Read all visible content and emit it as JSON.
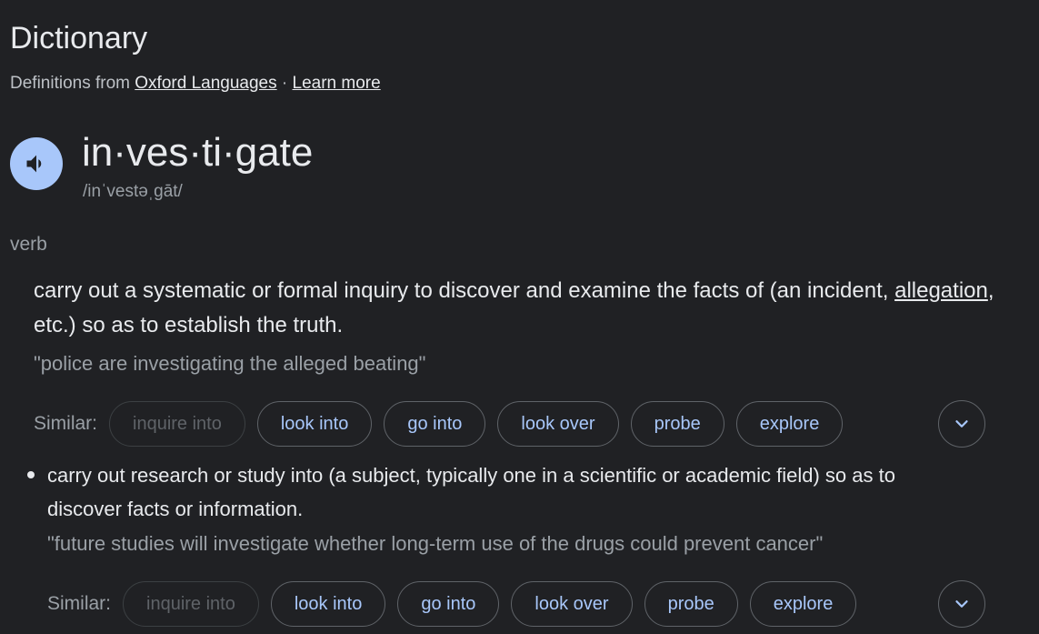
{
  "header": {
    "title": "Dictionary",
    "source_prefix": "Definitions from",
    "source_link": "Oxford Languages",
    "separator": "·",
    "learn_more": "Learn more"
  },
  "entry": {
    "headword": "in·ves·ti·gate",
    "pronunciation": "/inˈvestəˌgāt/",
    "part_of_speech": "verb",
    "speaker_icon": "volume-icon"
  },
  "senses": [
    {
      "definition_before": "carry out a systematic or formal inquiry to discover and examine the facts of (an incident, ",
      "definition_link": "allegation",
      "definition_after": ", etc.) so as to establish the truth.",
      "example": "\"police are investigating the alleged beating\"",
      "similar_label": "Similar:",
      "similar": [
        "inquire into",
        "look into",
        "go into",
        "look over",
        "probe",
        "explore"
      ]
    },
    {
      "definition": "carry out research or study into (a subject, typically one in a scientific or academic field) so as to discover facts or information.",
      "example": "\"future studies will investigate whether long-term use of the drugs could prevent cancer\"",
      "similar_label": "Similar:",
      "similar": [
        "inquire into",
        "look into",
        "go into",
        "look over",
        "probe",
        "explore"
      ]
    }
  ],
  "colors": {
    "background": "#202124",
    "chip_text": "#a8c7fa",
    "speaker_bg": "#a8c7fa"
  }
}
